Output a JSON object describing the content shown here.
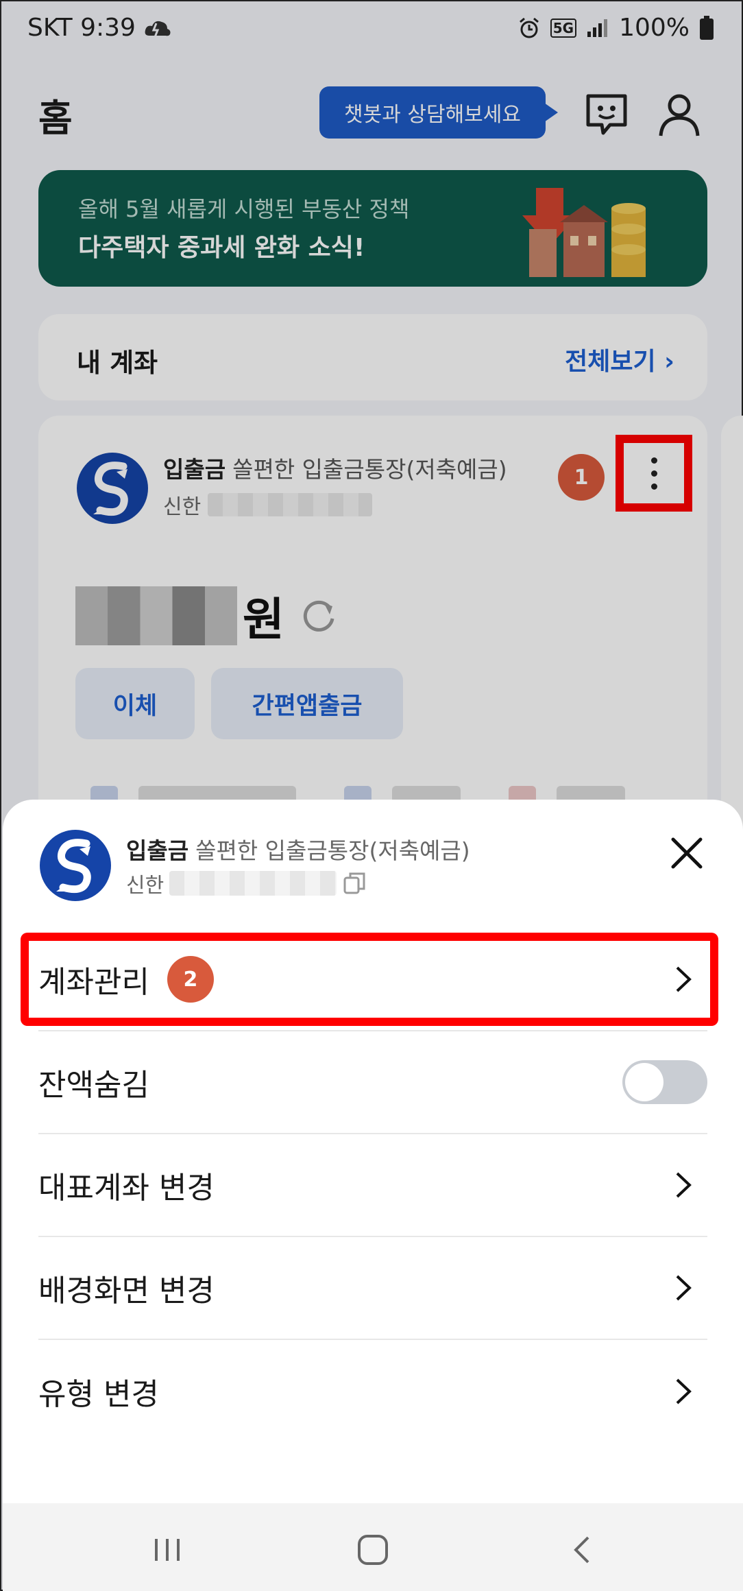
{
  "status_bar": {
    "carrier_time": "SKT 9:39",
    "network": "5G",
    "battery": "100%"
  },
  "header": {
    "title": "홈",
    "chatbot_tip": "챗봇과 상담해보세요"
  },
  "banner": {
    "line1": "올해 5월 새롭게 시행된 부동산 정책",
    "line2": "다주택자 중과세 완화 소식!"
  },
  "my_accounts": {
    "title": "내 계좌",
    "view_all": "전체보기 ›"
  },
  "account": {
    "kind": "입출금",
    "product": "쏠편한 입출금통장(저축예금)",
    "bank": "신한",
    "currency_unit": "원",
    "buttons": [
      "이체",
      "간편앱출금"
    ]
  },
  "steps": {
    "step1": "1",
    "step2": "2"
  },
  "sheet": {
    "kind": "입출금",
    "product": "쏠편한 입출금통장(저축예금)",
    "bank": "신한",
    "menu": [
      {
        "label": "계좌관리"
      },
      {
        "label": "잔액숨김"
      },
      {
        "label": "대표계좌 변경"
      },
      {
        "label": "배경화면 변경"
      },
      {
        "label": "유형 변경"
      }
    ],
    "balance_hidden": false
  },
  "colors": {
    "accent": "#1d5fd0",
    "highlight": "#ff0000",
    "badge": "#d85a3c",
    "banner_bg": "#0f5a4c"
  }
}
